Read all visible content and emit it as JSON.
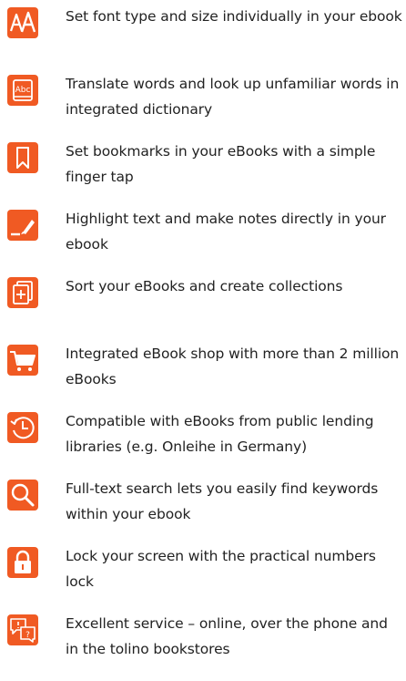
{
  "accent_color": "#F05A23",
  "features": [
    {
      "icon": "font-size-icon",
      "text": "Set font type and size individually in your ebook"
    },
    {
      "icon": "dictionary-icon",
      "text": "Translate words and look up unfamiliar words in integrated dictionary"
    },
    {
      "icon": "bookmark-icon",
      "text": "Set bookmarks in your eBooks with a simple finger tap"
    },
    {
      "icon": "highlighter-icon",
      "text": "Highlight text and make notes directly in your ebook"
    },
    {
      "icon": "collections-icon",
      "text": "Sort your eBooks and create collections"
    },
    {
      "icon": "shopping-cart-icon",
      "text": "Integrated eBook shop with more than 2 million eBooks"
    },
    {
      "icon": "history-clock-icon",
      "text": "Compatible with eBooks from public lending libraries (e.g. Onleihe in Germany)"
    },
    {
      "icon": "search-icon",
      "text": "Full-text search lets you easily find keywords within your ebook"
    },
    {
      "icon": "lock-icon",
      "text": "Lock your screen with the practical numbers lock"
    },
    {
      "icon": "service-chat-icon",
      "text": "Excellent service – online, over the phone and in the tolino bookstores"
    }
  ]
}
